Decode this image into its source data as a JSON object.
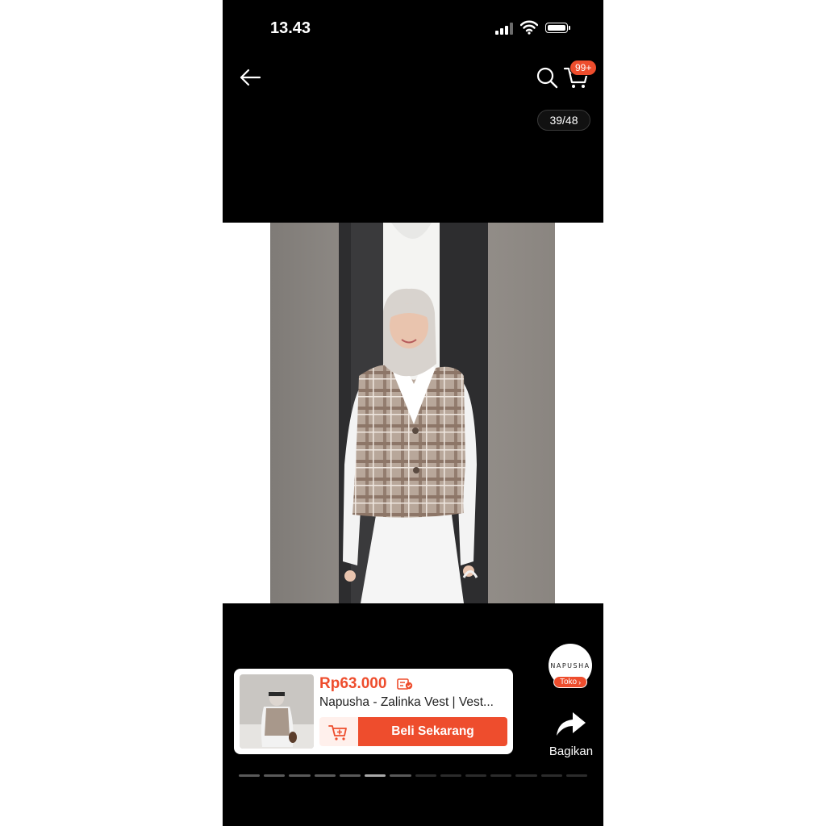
{
  "status_bar": {
    "time": "13.43"
  },
  "nav": {
    "cart_badge": "99+"
  },
  "gallery": {
    "counter": "39/48",
    "current_index": 39,
    "total": 48
  },
  "product": {
    "price": "Rp63.000",
    "name": "Napusha - Zalinka Vest  | Vest...",
    "buy_now_label": "Beli Sekarang"
  },
  "shop": {
    "name": "NAPUSHA",
    "badge_label": "Toko"
  },
  "share": {
    "label": "Bagikan"
  },
  "colors": {
    "accent": "#ee4d2d",
    "background": "#000000"
  },
  "icons": [
    "back-arrow-icon",
    "search-icon",
    "cart-icon",
    "voucher-icon",
    "add-to-cart-icon",
    "share-arrow-icon"
  ]
}
